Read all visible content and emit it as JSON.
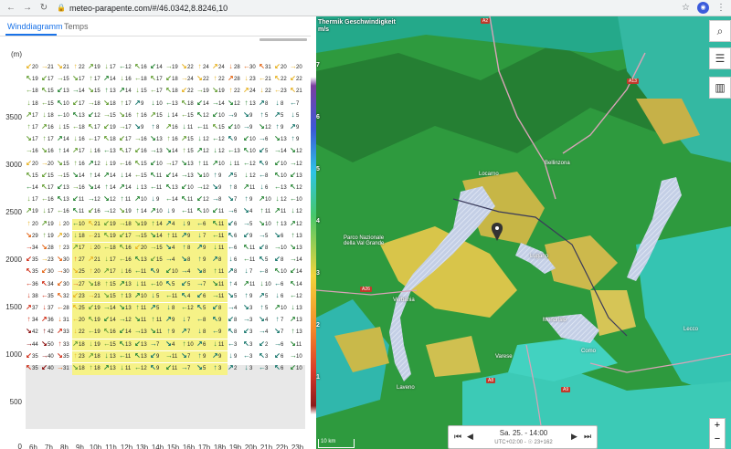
{
  "browser": {
    "url": "meteo-parapente.com/#/46.0342,8.8246,10"
  },
  "tabs": [
    {
      "label": "Winddiagramm",
      "active": true
    },
    {
      "label": "Temps",
      "active": false
    }
  ],
  "diagram": {
    "unit_label": "(m)",
    "y_ticks": [
      "3500",
      "3000",
      "2500",
      "2000",
      "1500",
      "1000",
      "500",
      "0"
    ],
    "hours": [
      "6h",
      "7h",
      "8h",
      "9h",
      "10h",
      "11h",
      "12h",
      "13h",
      "14h",
      "15h",
      "16h",
      "17h",
      "18h",
      "19h",
      "20h",
      "21h",
      "22h",
      "23h"
    ],
    "top_row": [
      "20",
      "21",
      "21",
      "22",
      "19",
      "17",
      "12",
      "16",
      "14",
      "19",
      "22",
      "24",
      "24",
      "28",
      "30",
      "31",
      "20",
      "20"
    ],
    "rows": [
      [
        "20",
        "21",
        "21",
        "22",
        "19",
        "17",
        "12",
        "16",
        "14",
        "19",
        "22",
        "24",
        "24",
        "28",
        "30",
        "31",
        "20",
        "20"
      ],
      [
        "19",
        "17",
        "15",
        "17",
        "17",
        "14",
        "16",
        "18",
        "17",
        "18",
        "24",
        "22",
        "22",
        "28",
        "23",
        "21",
        "22",
        "22"
      ],
      [
        "18",
        "15",
        "13",
        "14",
        "15",
        "13",
        "14",
        "15",
        "17",
        "18",
        "22",
        "19",
        "19",
        "22",
        "24",
        "22",
        "23",
        "21"
      ],
      [
        "18",
        "15",
        "10",
        "17",
        "18",
        "18",
        "17",
        "9",
        "10",
        "13",
        "18",
        "14",
        "14",
        "12",
        "13",
        "8",
        "8",
        "7"
      ],
      [
        "17",
        "18",
        "10",
        "13",
        "12",
        "15",
        "16",
        "16",
        "15",
        "14",
        "15",
        "12",
        "10",
        "9",
        "9",
        "5",
        "5",
        "5"
      ],
      [
        "17",
        "16",
        "15",
        "18",
        "17",
        "19",
        "17",
        "9",
        "8",
        "16",
        "11",
        "11",
        "15",
        "10",
        "9",
        "12",
        "9",
        "9"
      ],
      [
        "17",
        "17",
        "14",
        "16",
        "17",
        "18",
        "17",
        "16",
        "13",
        "16",
        "15",
        "12",
        "12",
        "9",
        "10",
        "6",
        "13",
        "9"
      ],
      [
        "16",
        "16",
        "14",
        "17",
        "16",
        "13",
        "17",
        "16",
        "13",
        "14",
        "15",
        "12",
        "12",
        "13",
        "10",
        "5",
        "14",
        "12"
      ],
      [
        "20",
        "20",
        "15",
        "16",
        "12",
        "19",
        "16",
        "15",
        "10",
        "17",
        "13",
        "11",
        "10",
        "11",
        "12",
        "9",
        "10",
        "12"
      ],
      [
        "15",
        "15",
        "15",
        "14",
        "14",
        "14",
        "14",
        "15",
        "11",
        "14",
        "13",
        "10",
        "9",
        "5",
        "12",
        "8",
        "10",
        "13"
      ],
      [
        "14",
        "17",
        "13",
        "16",
        "14",
        "14",
        "14",
        "13",
        "11",
        "13",
        "10",
        "12",
        "9",
        "8",
        "11",
        "6",
        "13",
        "12"
      ],
      [
        "17",
        "16",
        "13",
        "11",
        "12",
        "12",
        "11",
        "10",
        "9",
        "14",
        "11",
        "12",
        "8",
        "7",
        "9",
        "10",
        "12",
        "10"
      ],
      [
        "19",
        "17",
        "16",
        "11",
        "16",
        "12",
        "19",
        "14",
        "10",
        "9",
        "11",
        "10",
        "11",
        "6",
        "4",
        "11",
        "11",
        "12"
      ],
      [
        "20",
        "19",
        "20",
        "10",
        "21",
        "19",
        "18",
        "19",
        "14",
        "4",
        "9",
        "6",
        "11",
        "6",
        "5",
        "10",
        "13",
        "12"
      ],
      [
        "29",
        "19",
        "20",
        "18",
        "21",
        "19",
        "17",
        "15",
        "14",
        "11",
        "9",
        "7",
        "11",
        "6",
        "9",
        "5",
        "6",
        "13"
      ],
      [
        "34",
        "28",
        "23",
        "17",
        "20",
        "18",
        "16",
        "20",
        "15",
        "4",
        "8",
        "9",
        "11",
        "6",
        "11",
        "8",
        "10",
        "13"
      ],
      [
        "35",
        "23",
        "30",
        "27",
        "21",
        "17",
        "16",
        "13",
        "15",
        "4",
        "8",
        "9",
        "8",
        "6",
        "11",
        "5",
        "8",
        "14"
      ],
      [
        "35",
        "30",
        "30",
        "25",
        "20",
        "17",
        "16",
        "11",
        "9",
        "10",
        "4",
        "8",
        "11",
        "8",
        "7",
        "8",
        "10",
        "14"
      ],
      [
        "36",
        "34",
        "30",
        "27",
        "18",
        "15",
        "13",
        "11",
        "10",
        "5",
        "5",
        "7",
        "11",
        "4",
        "11",
        "10",
        "6",
        "14"
      ],
      [
        "38",
        "35",
        "32",
        "23",
        "21",
        "15",
        "13",
        "10",
        "5",
        "11",
        "4",
        "6",
        "11",
        "5",
        "9",
        "5",
        "6",
        "12"
      ],
      [
        "37",
        "37",
        "28",
        "25",
        "19",
        "14",
        "13",
        "11",
        "5",
        "8",
        "12",
        "5",
        "8",
        "4",
        "3",
        "5",
        "10",
        "13"
      ],
      [
        "34",
        "36",
        "31",
        "20",
        "19",
        "14",
        "12",
        "11",
        "11",
        "9",
        "7",
        "8",
        "9",
        "8",
        "3",
        "4",
        "7",
        "13"
      ],
      [
        "42",
        "42",
        "33",
        "22",
        "19",
        "16",
        "14",
        "13",
        "11",
        "9",
        "7",
        "8",
        "9",
        "8",
        "3",
        "4",
        "7",
        "13"
      ],
      [
        "44",
        "50",
        "33",
        "18",
        "19",
        "15",
        "13",
        "13",
        "7",
        "4",
        "10",
        "6",
        "11",
        "3",
        "3",
        "2",
        "6",
        "11"
      ],
      [
        "35",
        "40",
        "35",
        "23",
        "18",
        "13",
        "11",
        "13",
        "9",
        "11",
        "7",
        "9",
        "9",
        "9",
        "3",
        "3",
        "6",
        "10"
      ],
      [
        "35",
        "40",
        "31",
        "18",
        "18",
        "13",
        "11",
        "12",
        "9",
        "11",
        "7",
        "5",
        "3",
        "2",
        "3",
        "3",
        "6",
        "10"
      ]
    ]
  },
  "map": {
    "title": "Thermik Geschwindigkeit",
    "unit": "m/s",
    "scale_values": [
      "7",
      "6",
      "5",
      "4",
      "3",
      "2",
      "1"
    ],
    "time_label": "Sa. 25. - 14:00",
    "time_sub": "UTC+02:00 - ☉ 23+162",
    "scale_bar": "10 km",
    "places": [
      "Locarno",
      "Bellinzona",
      "Verbania",
      "Varese",
      "Como",
      "Lecco",
      "Mendrisio",
      "Lugano",
      "Parco Nazionale della Val Grande",
      "Laveno"
    ],
    "roads": [
      "A2",
      "A13",
      "A26",
      "A9",
      "A8"
    ],
    "colors": {
      "forest": "#2e9a3e",
      "lake": "#b9c8e8",
      "thermal_high": "#d8c54a",
      "thermal_low": "#31c5b9"
    }
  }
}
